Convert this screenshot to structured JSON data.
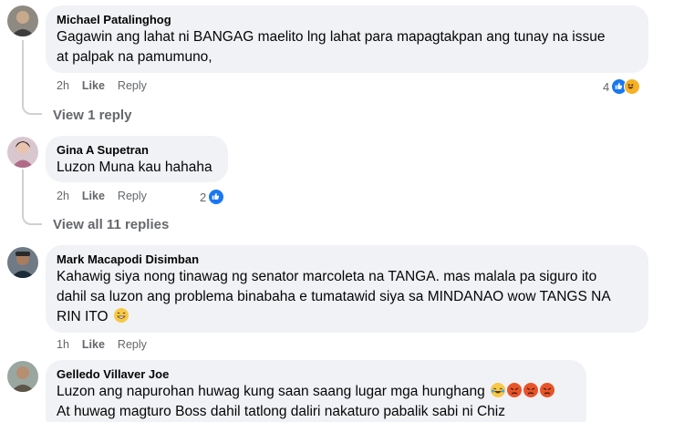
{
  "comments": [
    {
      "author": "Michael Patalinghog",
      "text_lines": [
        "Gagawin ang lahat ni BANGAG maelito lng lahat para mapagtakpan ang tunay na issue",
        "at palpak na pamumuno,"
      ],
      "time": "2h",
      "like_label": "Like",
      "reply_label": "Reply",
      "reaction_count": "4",
      "reactions": [
        "like-icon",
        "haha-icon"
      ],
      "view_replies": "View 1 reply"
    },
    {
      "author": "Gina A Supetran",
      "text_lines": [
        "Luzon Muna kau hahaha"
      ],
      "time": "2h",
      "like_label": "Like",
      "reply_label": "Reply",
      "reaction_count": "2",
      "reactions": [
        "like-icon"
      ],
      "view_replies": "View all 11 replies"
    },
    {
      "author": "Mark Macapodi Disimban",
      "text_lines": [
        "Kahawig siya nong tinawag ng senator marcoleta na TANGA. mas malala pa siguro ito",
        "dahil sa luzon ang problema binabaha e tumatawid siya sa MINDANAO wow TANGS NA",
        "RIN ITO"
      ],
      "inline_emoji": [
        "grinning-sweat-emoji"
      ],
      "time": "1h",
      "like_label": "Like",
      "reply_label": "Reply"
    },
    {
      "author": "Gelledo Villaver Joe",
      "text_lines": [
        "Luzon ang napurohan huwag kung saan saang lugar mga hunghang",
        "At huwag magturo Boss dahil tatlong daliri nakaturo pabalik sabi ni Chiz"
      ],
      "inline_emoji": [
        "crying-laugh-emoji",
        "angry-emoji",
        "angry-emoji",
        "angry-emoji"
      ]
    }
  ],
  "colors": {
    "bubble": "#f0f2f5",
    "secondary_text": "#65676b",
    "like_blue": "#1877f2",
    "thread_line": "#ced0d4"
  }
}
